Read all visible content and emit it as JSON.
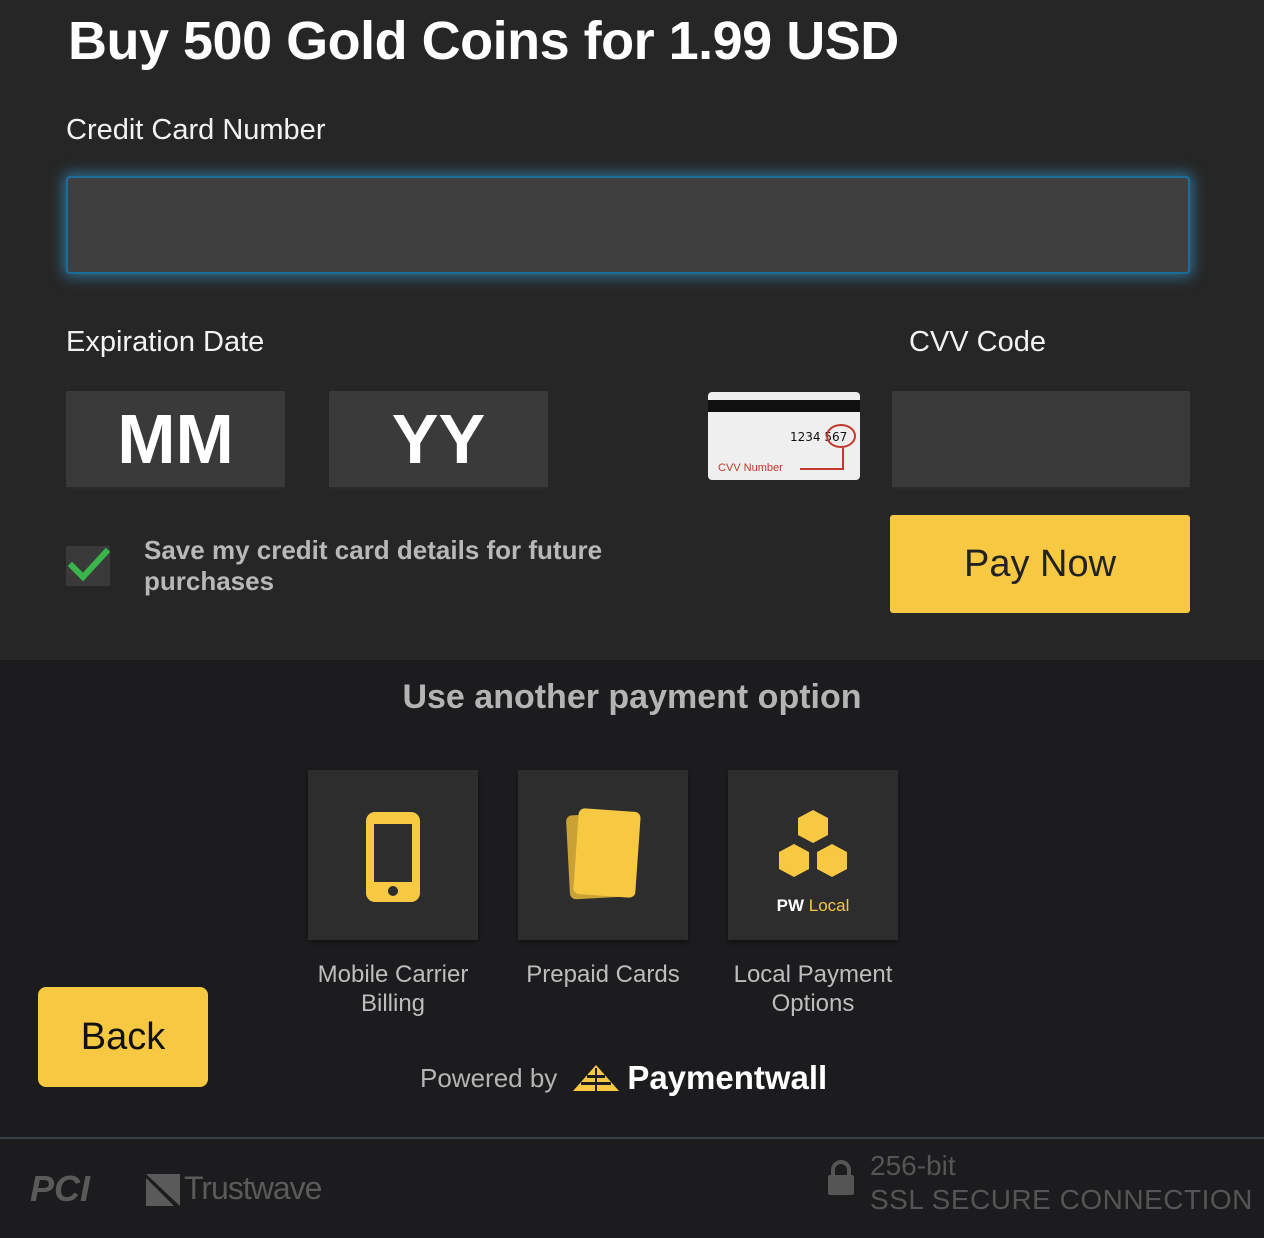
{
  "header": {
    "title": "Buy 500 Gold Coins for 1.99 USD"
  },
  "card_form": {
    "cc_label": "Credit Card Number",
    "cc_value": "",
    "expiration_label": "Expiration Date",
    "month_placeholder": "MM",
    "year_placeholder": "YY",
    "cvv_label": "CVV Code",
    "cvv_value": "",
    "cvv_card": {
      "card_digits": "1234",
      "cvv_digits": "567",
      "caption": "CVV Number"
    },
    "save_checked": true,
    "save_label": "Save my credit card details for future purchases",
    "pay_label": "Pay Now"
  },
  "alternatives": {
    "title": "Use another payment option",
    "options": [
      {
        "label": "Mobile Carrier Billing",
        "icon": "mobile-phone-icon"
      },
      {
        "label": "Prepaid Cards",
        "icon": "prepaid-cards-icon"
      },
      {
        "label": "Local Payment Options",
        "icon": "pw-local-icon",
        "badge_pw": "PW",
        "badge_local": "Local"
      }
    ]
  },
  "back_label": "Back",
  "powered": {
    "prefix": "Powered by",
    "brand": "Paymentwall"
  },
  "footer": {
    "pci_logo": "PCI",
    "trustwave_logo": "Trustwave",
    "ssl_line1": "256-bit",
    "ssl_line2": "SSL SECURE CONNECTION"
  },
  "colors": {
    "accent": "#f7c841",
    "background": "#262626",
    "focus_glow": "#38aae6"
  }
}
